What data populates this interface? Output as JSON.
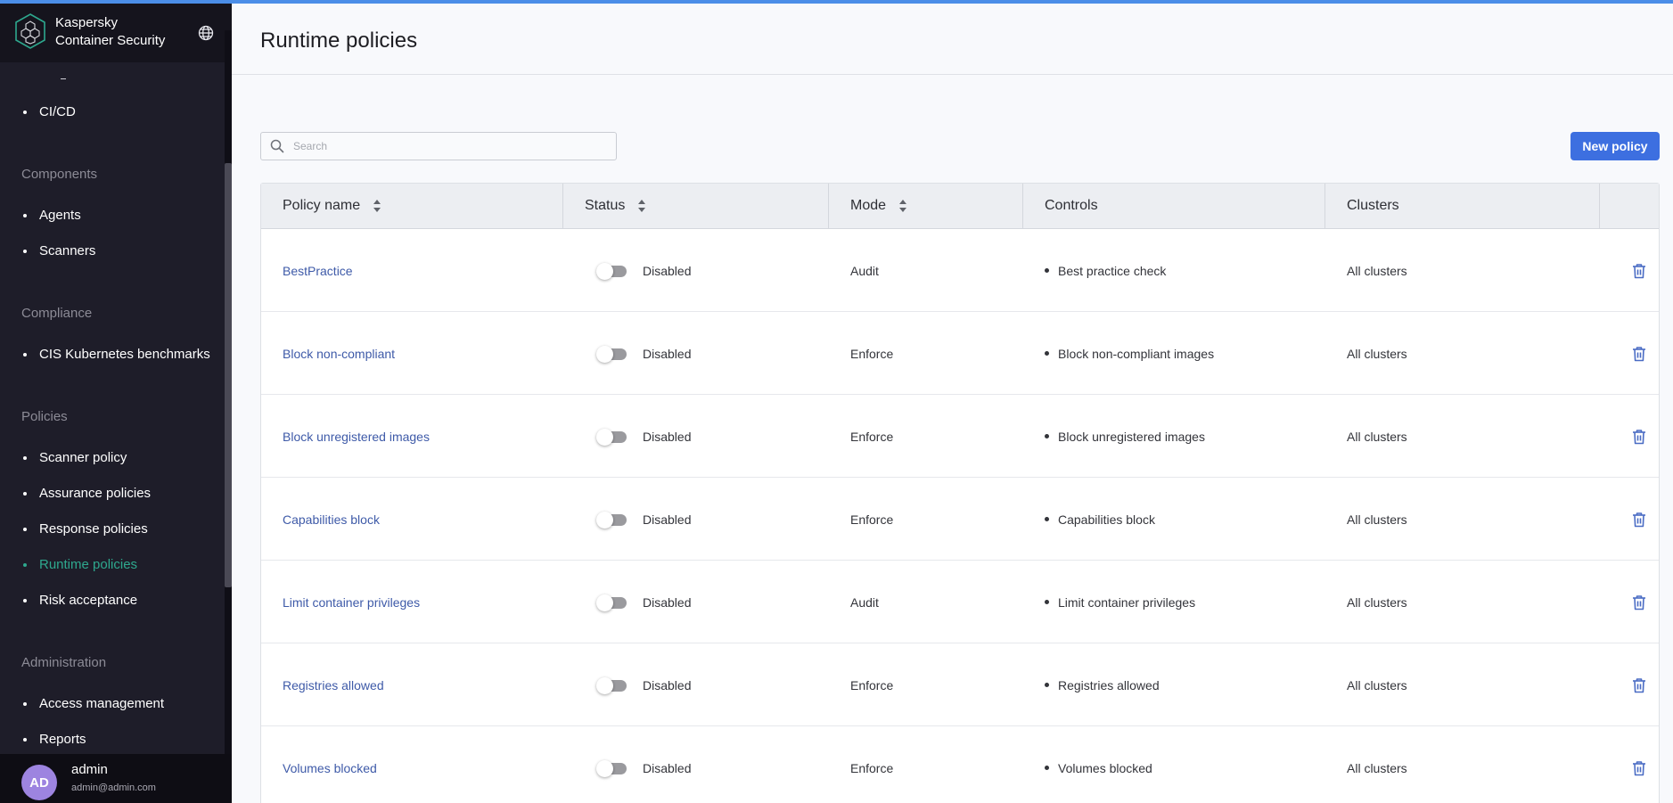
{
  "app": {
    "brand_line1": "Kaspersky",
    "brand_line2": "Container Security"
  },
  "sidebar": {
    "sections": [
      {
        "label": "Components"
      },
      {
        "label": "Compliance"
      },
      {
        "label": "Policies"
      },
      {
        "label": "Administration"
      }
    ],
    "items": [
      {
        "label": "CI/CD"
      },
      {
        "label": "Agents"
      },
      {
        "label": "Scanners"
      },
      {
        "label": "CIS Kubernetes benchmarks"
      },
      {
        "label": "Scanner policy"
      },
      {
        "label": "Assurance policies"
      },
      {
        "label": "Response policies"
      },
      {
        "label": "Runtime policies",
        "active": true
      },
      {
        "label": "Risk acceptance"
      },
      {
        "label": "Access management"
      },
      {
        "label": "Reports"
      }
    ],
    "active_color": "#2ea88e"
  },
  "user": {
    "initials": "AD",
    "name": "admin",
    "email": "admin@admin.com"
  },
  "page": {
    "title": "Runtime policies",
    "search_placeholder": "Search",
    "search_value": "",
    "new_button": "New policy"
  },
  "table": {
    "columns": [
      "Policy name",
      "Status",
      "Mode",
      "Controls",
      "Clusters"
    ],
    "rows": [
      {
        "name": "BestPractice",
        "status": "Disabled",
        "enabled": false,
        "mode": "Audit",
        "control": "Best practice check",
        "clusters": "All clusters"
      },
      {
        "name": "Block non-compliant",
        "status": "Disabled",
        "enabled": false,
        "mode": "Enforce",
        "control": "Block non-compliant images",
        "clusters": "All clusters"
      },
      {
        "name": "Block unregistered images",
        "status": "Disabled",
        "enabled": false,
        "mode": "Enforce",
        "control": "Block unregistered images",
        "clusters": "All clusters"
      },
      {
        "name": "Capabilities block",
        "status": "Disabled",
        "enabled": false,
        "mode": "Enforce",
        "control": "Capabilities block",
        "clusters": "All clusters"
      },
      {
        "name": "Limit container privileges",
        "status": "Disabled",
        "enabled": false,
        "mode": "Audit",
        "control": "Limit container privileges",
        "clusters": "All clusters"
      },
      {
        "name": "Registries allowed",
        "status": "Disabled",
        "enabled": false,
        "mode": "Enforce",
        "control": "Registries allowed",
        "clusters": "All clusters"
      },
      {
        "name": "Volumes blocked",
        "status": "Disabled",
        "enabled": false,
        "mode": "Enforce",
        "control": "Volumes blocked",
        "clusters": "All clusters"
      }
    ]
  },
  "icons": {
    "logo": "kaspersky-cubes-hexagon-icon",
    "language": "globe-icon",
    "search": "search-icon",
    "sort": "sort-icon",
    "delete": "trash-icon"
  },
  "colors": {
    "accent": "#3d6fe0",
    "link": "#3e5aa8",
    "top_bar": "#4b8ee8",
    "sidebar_bg": "#1e1d29",
    "avatar": "#9d84e0"
  }
}
